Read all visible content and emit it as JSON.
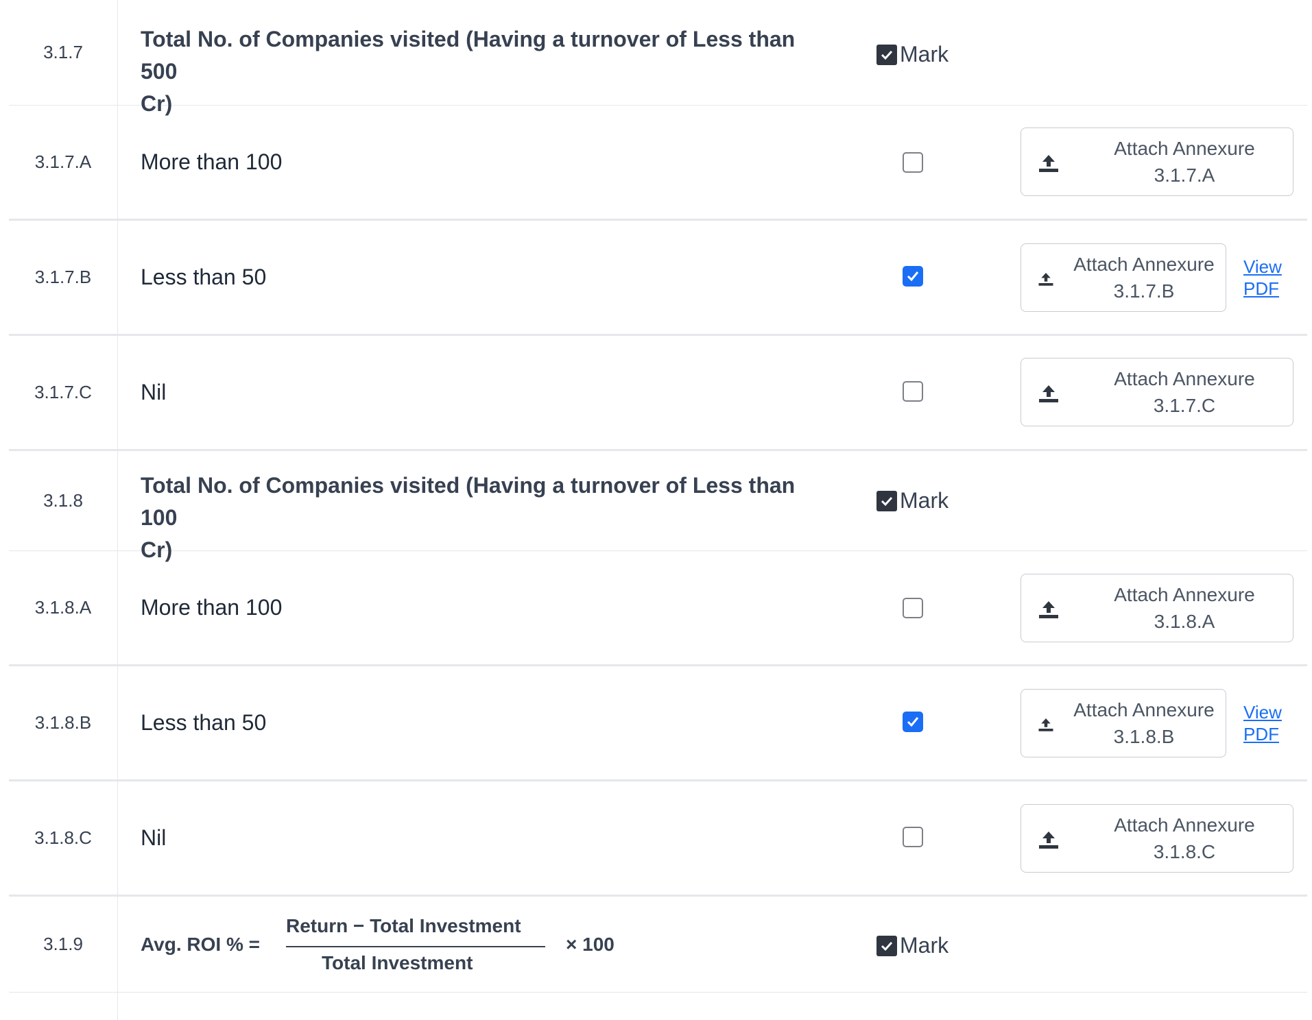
{
  "mark_label": "Mark",
  "attach_label": "Attach Annexure",
  "view_pdf": {
    "line1": "View",
    "line2": "PDF"
  },
  "rows": {
    "r317": {
      "code": "3.1.7",
      "line1": "Total No. of Companies visited (Having a turnover of Less than 500",
      "line2": "Cr)"
    },
    "r317a": {
      "code": "3.1.7.A",
      "label": "More than 100",
      "annex": "3.1.7.A",
      "checked": false
    },
    "r317b": {
      "code": "3.1.7.B",
      "label": "Less than 50",
      "annex": "3.1.7.B",
      "checked": true
    },
    "r317c": {
      "code": "3.1.7.C",
      "label": "Nil",
      "annex": "3.1.7.C",
      "checked": false
    },
    "r318": {
      "code": "3.1.8",
      "line1": "Total No. of Companies visited (Having a turnover of Less than 100",
      "line2": "Cr)"
    },
    "r318a": {
      "code": "3.1.8.A",
      "label": "More than 100",
      "annex": "3.1.8.A",
      "checked": false
    },
    "r318b": {
      "code": "3.1.8.B",
      "label": "Less than 50",
      "annex": "3.1.8.B",
      "checked": true
    },
    "r318c": {
      "code": "3.1.8.C",
      "label": "Nil",
      "annex": "3.1.8.C",
      "checked": false
    },
    "r319": {
      "code": "3.1.9",
      "formula": {
        "lhs": "Avg. ROI % =",
        "numerator": "Return − Total Investment",
        "denominator": "Total Investment",
        "multiplier": "× 100"
      }
    }
  },
  "colors": {
    "accent": "#1a6ef5",
    "mark_box": "#2f3640",
    "border": "#e5e7eb"
  },
  "icons": {
    "mark": "check-square-icon",
    "attach": "upload-icon"
  }
}
